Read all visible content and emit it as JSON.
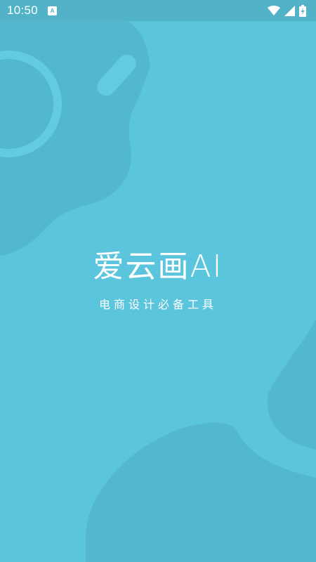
{
  "status_bar": {
    "time": "10:50",
    "notification_icon": "A",
    "icons": [
      "wifi-icon",
      "cell-signal-icon",
      "battery-charging-icon"
    ]
  },
  "splash": {
    "title": "爱云画AI",
    "slogan": "电商设计必备工具"
  },
  "colors": {
    "background": "#5BC5DD",
    "status_bar": "#52B2C7",
    "decor_shape": "#52B7CF",
    "text": "#FFFFFF"
  }
}
